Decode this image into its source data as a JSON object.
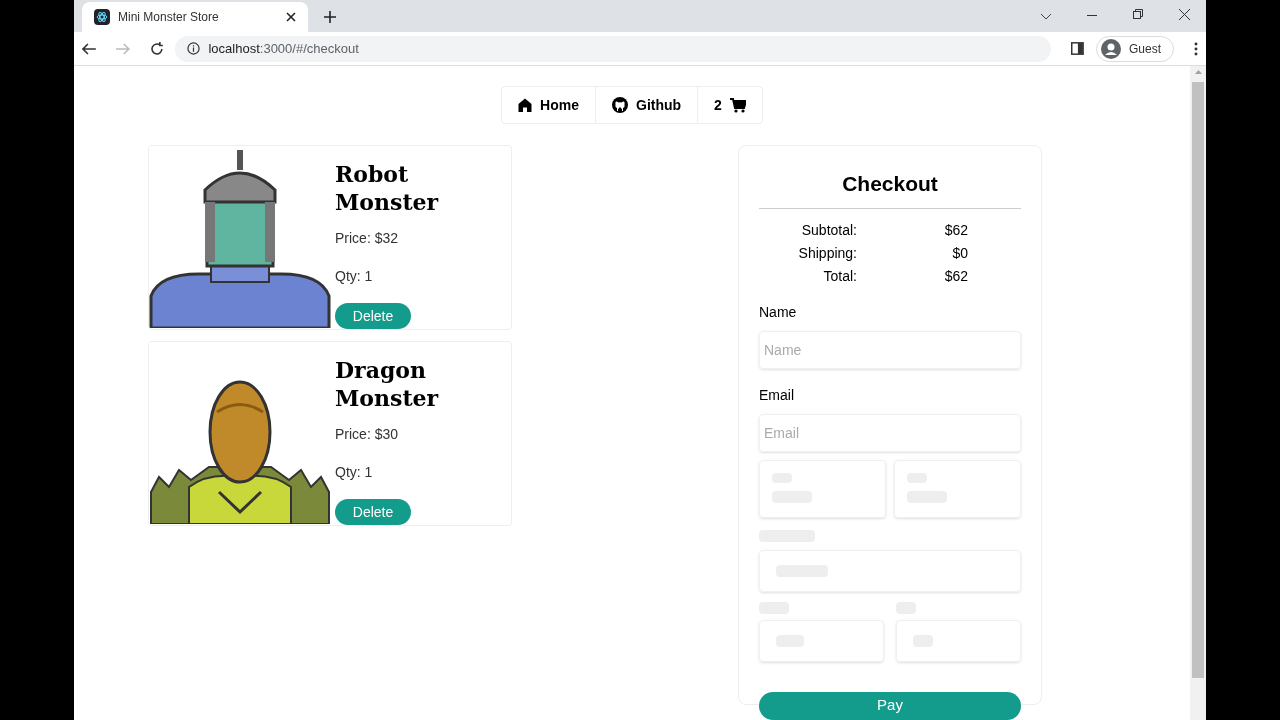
{
  "browser": {
    "tab_title": "Mini Monster Store",
    "url_host": "localhost",
    "url_path": ":3000/#/checkout",
    "profile": "Guest"
  },
  "nav": [
    {
      "kind": "home",
      "label": "Home"
    },
    {
      "kind": "github",
      "label": "Github"
    },
    {
      "kind": "cart",
      "label": "2"
    }
  ],
  "cart_items": [
    {
      "name": "Robot Monster",
      "price": "Price: $32",
      "qty": "Qty: 1",
      "button": "Delete",
      "kind": "robot"
    },
    {
      "name": "Dragon Monster",
      "price": "Price: $30",
      "qty": "Qty: 1",
      "button": "Delete",
      "kind": "dragon"
    }
  ],
  "checkout": {
    "title": "Checkout",
    "summary": [
      {
        "label": "Subtotal:",
        "value": "$62"
      },
      {
        "label": "Shipping:",
        "value": "$0"
      },
      {
        "label": "Total:",
        "value": "$62"
      }
    ],
    "fields": [
      {
        "label": "Name",
        "placeholder": "Name"
      },
      {
        "label": "Email",
        "placeholder": "Email"
      }
    ],
    "pay_button": "Pay"
  }
}
